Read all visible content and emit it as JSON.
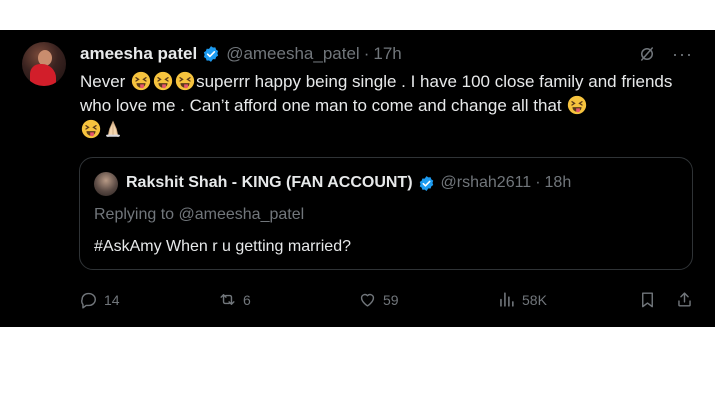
{
  "tweet": {
    "author_name": "ameesha patel",
    "author_handle": "@ameesha_patel",
    "separator": "·",
    "time": "17h",
    "text_part1": "Never ",
    "text_part2": "superrr happy being single . I have 100 close family and friends who love me . Can’t afford one man to come and change all that ",
    "emoji_icons": [
      "squinting-tongue-emoji",
      "folded-hands-emoji"
    ],
    "more_label": "···"
  },
  "quote": {
    "author_name": "Rakshit Shah - KING (FAN ACCOUNT)",
    "author_handle": "@rshah2611",
    "separator": "·",
    "time": "18h",
    "replying_prefix": "Replying to ",
    "replying_handle": "@ameesha_patel",
    "text": "#AskAmy When r u getting married?"
  },
  "actions": {
    "replies": "14",
    "reposts": "6",
    "likes": "59",
    "views": "58K"
  },
  "colors": {
    "background": "#000000",
    "text": "#e7e9ea",
    "muted": "#71767b",
    "verified": "#1d9bf0",
    "border": "#2f3336"
  }
}
